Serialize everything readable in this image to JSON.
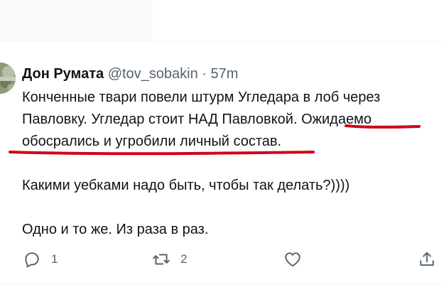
{
  "tweet": {
    "author_name": "Дон Румата",
    "author_handle": "@tov_sobakin",
    "separator": "·",
    "time": "57m",
    "lines": [
      "Конченные твари повели штурм Угледара в лоб через",
      "Павловку. Угледар стоит НАД Павловкой. Ожидаемо",
      "обосрались и угробили личный состав.",
      "Какими уебками надо быть, чтобы так делать?))))",
      "Одно и то же. Из раза в раз."
    ]
  },
  "actions": {
    "reply": {
      "icon": "reply-icon",
      "count": "1"
    },
    "retweet": {
      "icon": "retweet-icon",
      "count": "2"
    },
    "like": {
      "icon": "heart-icon",
      "count": ""
    },
    "share": {
      "icon": "share-icon",
      "count": ""
    }
  },
  "colors": {
    "text": "#0f1419",
    "muted": "#536471",
    "underline": "#d0021b"
  }
}
